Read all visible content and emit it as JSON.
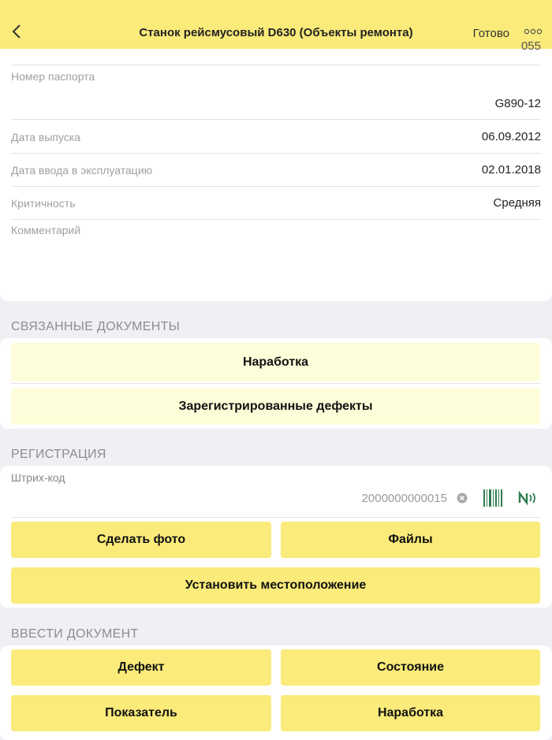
{
  "header": {
    "back_icon": "chevron-left-icon",
    "title": "Станок рейсмусовый D630 (Объекты ремонта)",
    "done_label": "Готово",
    "more_icon": "ellipsis-icon"
  },
  "details": {
    "top_partial_value": "055",
    "passport": {
      "label": "Номер паспорта",
      "value": "G890-12"
    },
    "release_date": {
      "label": "Дата выпуска",
      "value": "06.09.2012"
    },
    "commission_date": {
      "label": "Дата ввода в эксплуатацию",
      "value": "02.01.2018"
    },
    "criticality": {
      "label": "Критичность",
      "value": "Средняя"
    },
    "comment": {
      "label": "Комментарий",
      "value": ""
    }
  },
  "related_documents": {
    "heading": "СВЯЗАННЫЕ ДОКУМЕНТЫ",
    "buttons": [
      "Наработка",
      "Зарегистрированные дефекты"
    ]
  },
  "registration": {
    "heading": "РЕГИСТРАЦИЯ",
    "barcode_label": "Штрих-код",
    "barcode_value": "2000000000015",
    "clear_icon": "clear-icon",
    "barcode_icon": "barcode-icon",
    "nfc_icon": "nfc-icon",
    "photo_button": "Сделать фото",
    "files_button": "Файлы",
    "location_button": "Установить местоположение"
  },
  "enter_document": {
    "heading": "ВВЕСТИ ДОКУМЕНТ",
    "buttons": [
      "Дефект",
      "Состояние",
      "Показатель",
      "Наработка"
    ]
  },
  "colors": {
    "accent": "#faeb7a",
    "accent_light": "#fefdd9",
    "background": "#efeff4",
    "barcode_green": "#2e7d4f"
  }
}
